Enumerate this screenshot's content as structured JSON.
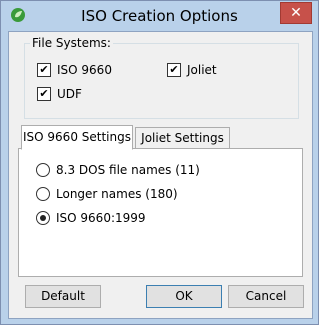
{
  "window": {
    "title": "ISO Creation Options",
    "close_glyph": "✕",
    "app_icon": "green-leaf-icon"
  },
  "file_systems": {
    "legend": "File Systems:",
    "items": [
      {
        "label": "ISO 9660",
        "checked": true
      },
      {
        "label": "Joliet",
        "checked": true
      },
      {
        "label": "UDF",
        "checked": true
      }
    ]
  },
  "tabs": [
    {
      "label": "ISO 9660 Settings",
      "active": true
    },
    {
      "label": "Joliet Settings",
      "active": false
    }
  ],
  "naming": {
    "options": [
      {
        "label": "8.3 DOS file names (11)",
        "selected": false
      },
      {
        "label": "Longer names (180)",
        "selected": false
      },
      {
        "label": "ISO 9660:1999",
        "selected": true
      }
    ]
  },
  "buttons": {
    "default_label": "Default",
    "ok_label": "OK",
    "cancel_label": "Cancel"
  },
  "check_glyph": "✔"
}
